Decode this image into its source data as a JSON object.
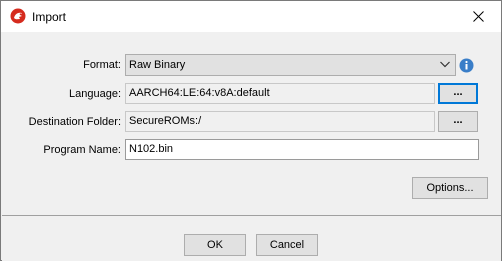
{
  "window": {
    "title": "Import",
    "close_glyph": "✕"
  },
  "form": {
    "format": {
      "label": "Format:",
      "value": "Raw Binary"
    },
    "language": {
      "label": "Language:",
      "value": "AARCH64:LE:64:v8A:default",
      "browse_label": "..."
    },
    "destination": {
      "label": "Destination Folder:",
      "value": "SecureROMs:/",
      "browse_label": "..."
    },
    "program_name": {
      "label": "Program Name:",
      "value": "N102.bin"
    },
    "options_label": "Options..."
  },
  "footer": {
    "ok_label": "OK",
    "cancel_label": "Cancel"
  },
  "colors": {
    "accent_focus": "#0078d7",
    "info_blue": "#3a7ec8",
    "app_icon_red": "#d52b1e"
  },
  "icons": [
    "dragon-app-icon",
    "close-icon",
    "chevron-down-icon",
    "info-icon"
  ]
}
